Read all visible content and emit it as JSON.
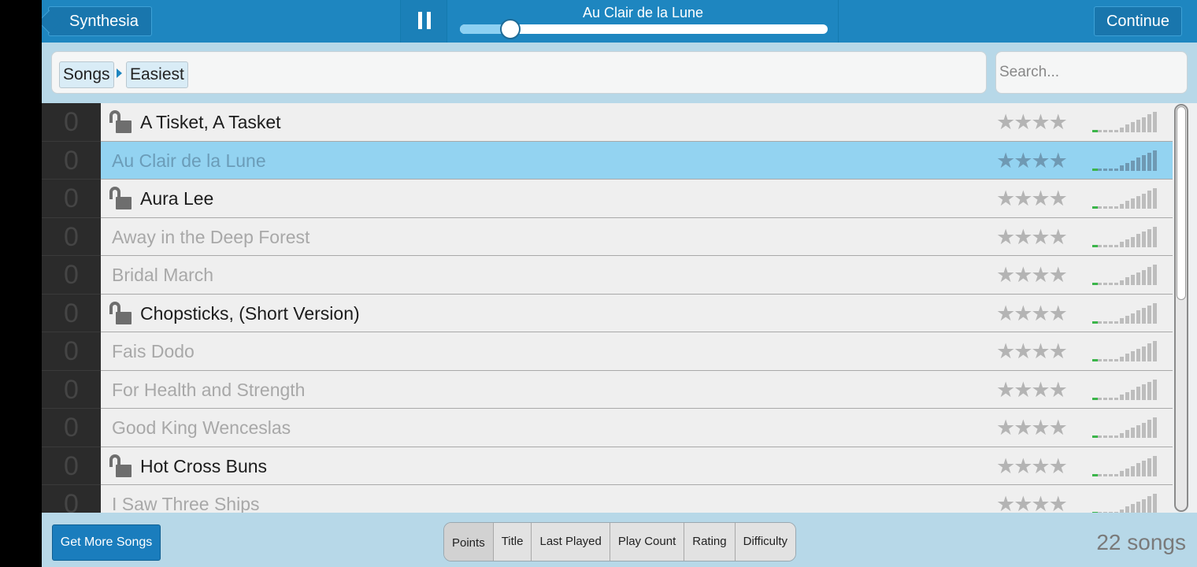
{
  "header": {
    "back_label": "Synthesia",
    "now_playing": "Au Clair de la Lune",
    "progress": 0.14,
    "continue_label": "Continue"
  },
  "breadcrumb": [
    "Songs",
    "Easiest"
  ],
  "search": {
    "placeholder": "Search...",
    "value": ""
  },
  "songs": [
    {
      "points": "0",
      "title": "A Tisket, A Tasket",
      "unlocked": true,
      "selected": false,
      "difficulty": 1
    },
    {
      "points": "0",
      "title": "Au Clair de la Lune",
      "unlocked": false,
      "selected": true,
      "difficulty": 1
    },
    {
      "points": "0",
      "title": "Aura Lee",
      "unlocked": true,
      "selected": false,
      "difficulty": 1
    },
    {
      "points": "0",
      "title": "Away in the Deep Forest",
      "unlocked": false,
      "selected": false,
      "difficulty": 1
    },
    {
      "points": "0",
      "title": "Bridal March",
      "unlocked": false,
      "selected": false,
      "difficulty": 1
    },
    {
      "points": "0",
      "title": "Chopsticks, (Short Version)",
      "unlocked": true,
      "selected": false,
      "difficulty": 1
    },
    {
      "points": "0",
      "title": "Fais Dodo",
      "unlocked": false,
      "selected": false,
      "difficulty": 1
    },
    {
      "points": "0",
      "title": "For Health and Strength",
      "unlocked": false,
      "selected": false,
      "difficulty": 1
    },
    {
      "points": "0",
      "title": "Good King Wenceslas",
      "unlocked": false,
      "selected": false,
      "difficulty": 1
    },
    {
      "points": "0",
      "title": "Hot Cross Buns",
      "unlocked": true,
      "selected": false,
      "difficulty": 1
    },
    {
      "points": "0",
      "title": "I Saw Three Ships",
      "unlocked": false,
      "selected": false,
      "difficulty": 1
    }
  ],
  "stars_glyph": "★★★★",
  "footer": {
    "get_more_label": "Get More Songs",
    "sort_tabs": [
      "Points",
      "Title",
      "Last Played",
      "Play Count",
      "Rating",
      "Difficulty"
    ],
    "active_sort": "Points",
    "song_count": "22 songs"
  },
  "colors": {
    "accent": "#1e86c0",
    "selected_row": "#93d3f1",
    "difficulty_on": "#3bb54a"
  }
}
